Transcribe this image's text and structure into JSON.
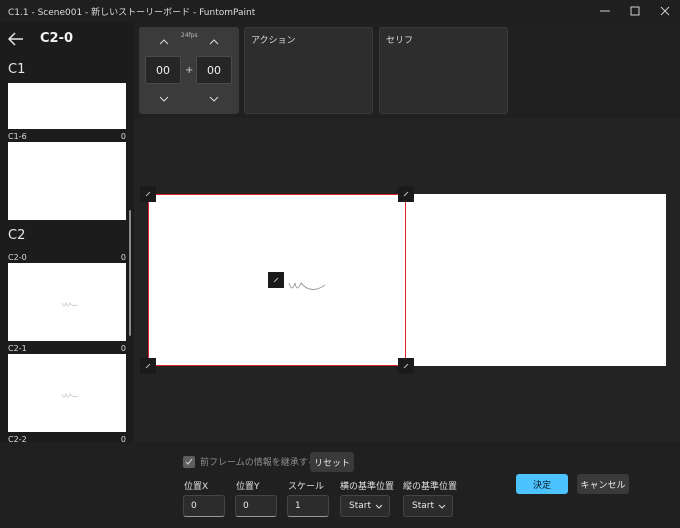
{
  "window": {
    "title": "C1.1 - Scene001 - 新しいストーリーボード - FuntomPaint",
    "minimize_glyph": "—",
    "maximize_glyph": "☐",
    "close_glyph": "✕"
  },
  "sidebar": {
    "current_shot": "C2-0",
    "groups": [
      {
        "label": "C1"
      },
      {
        "label": "C2"
      }
    ],
    "thumbnails": [
      {
        "name": "C1-6",
        "count": "0"
      },
      {
        "name": "C2-0",
        "count": "0"
      },
      {
        "name": "C2-1",
        "count": "0"
      },
      {
        "name": "C2-2",
        "count": "0"
      }
    ]
  },
  "frame_control": {
    "fps": "24fps",
    "seconds": "00",
    "frames": "00",
    "plus": "+"
  },
  "panels": {
    "action_title": "アクション",
    "dialogue_title": "セリフ"
  },
  "bottom": {
    "inherit_label": "前フレームの情報を継承する",
    "inherit_checked": true,
    "reset_label": "リセット",
    "pos_x_label": "位置X",
    "pos_x_value": "0",
    "pos_y_label": "位置Y",
    "pos_y_value": "0",
    "scale_label": "スケール",
    "scale_value": "1",
    "h_anchor_label": "横の基準位置",
    "h_anchor_value": "Start",
    "v_anchor_label": "縦の基準位置",
    "v_anchor_value": "Start",
    "ok_label": "決定",
    "cancel_label": "キャンセル"
  },
  "colors": {
    "accent": "#4cc2ff",
    "selection_border": "#e0202a"
  }
}
